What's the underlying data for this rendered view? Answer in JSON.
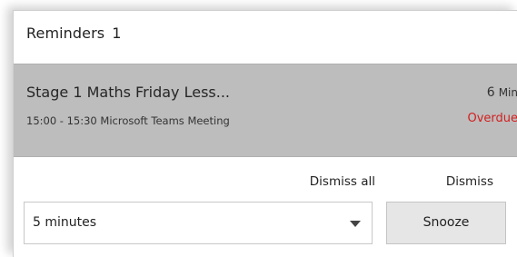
{
  "header": {
    "title": "Reminders",
    "count": "1"
  },
  "reminder": {
    "title": "Stage 1 Maths Friday Less...",
    "time_range": "15:00 - 15:30",
    "location": "Microsoft Teams Meeting",
    "duration_value": "6",
    "duration_unit": "Min",
    "status": "Overdue"
  },
  "actions": {
    "dismiss_all": "Dismiss all",
    "dismiss": "Dismiss"
  },
  "snooze": {
    "selected_option": "5 minutes",
    "button_label": "Snooze"
  },
  "colors": {
    "selected_item_bg": "#bdbdbd",
    "overdue": "#d21f1f",
    "button_bg": "#e6e6e6"
  }
}
